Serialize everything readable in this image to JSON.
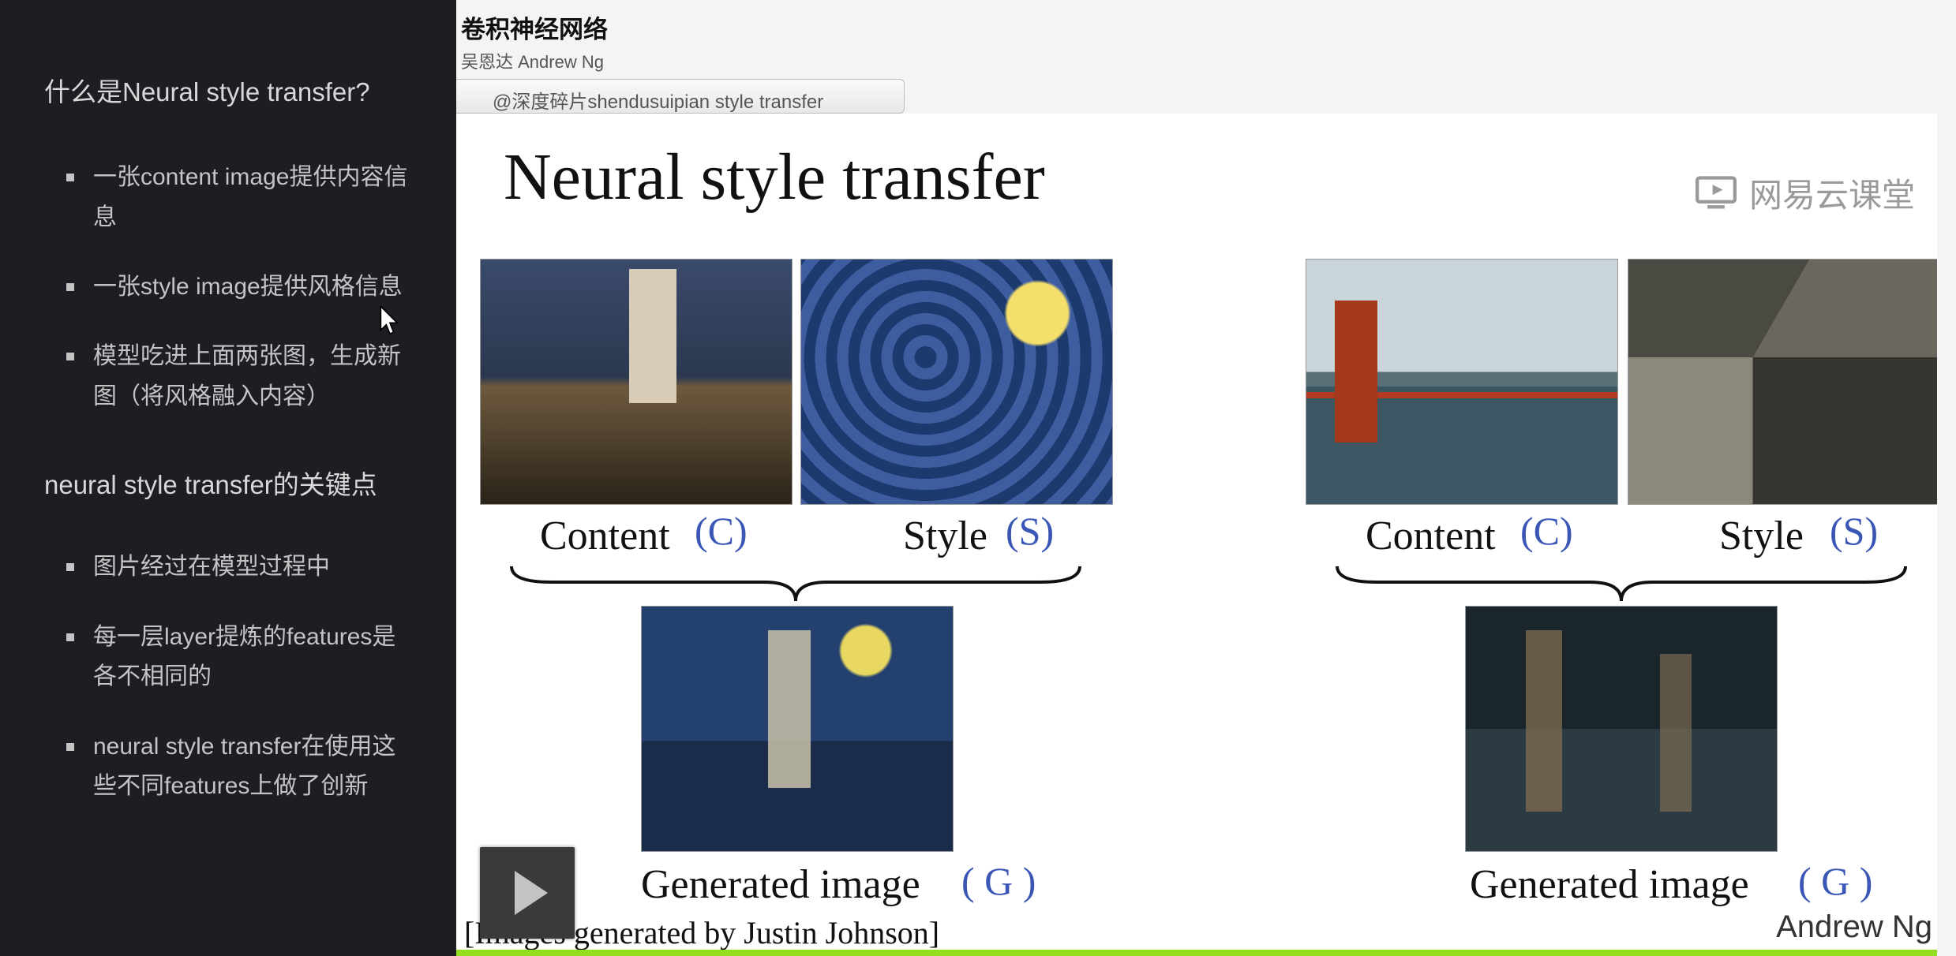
{
  "sidebar": {
    "heading1": "什么是Neural style transfer?",
    "list1": [
      "一张content image提供内容信息",
      "一张style image提供风格信息",
      "模型吃进上面两张图，生成新图（将风格融入内容）"
    ],
    "heading2": "neural style transfer的关键点",
    "list2": [
      "图片经过在模型过程中",
      "每一层layer提炼的features是各不相同的",
      "neural style transfer在使用这些不同features上做了创新"
    ]
  },
  "header": {
    "course_title": "卷积神经网络",
    "course_author": "吴恩达 Andrew Ng"
  },
  "watermark_tab": "@深度碎片shendusuipian style transfer",
  "slide": {
    "title": "Neural style transfer",
    "provider": "网易云课堂",
    "provider_icon": "monitor-play-icon",
    "left": {
      "content_label": "Content",
      "content_hand": "(C)",
      "style_label": "Style",
      "style_hand": "(S)",
      "generated_label": "Generated image",
      "generated_hand": "( G )"
    },
    "right": {
      "content_label": "Content",
      "content_hand": "(C)",
      "style_label": "Style",
      "style_hand": "(S)",
      "generated_label": "Generated image",
      "generated_hand": "( G )"
    },
    "images": {
      "c1": "hoover-tower-photo",
      "s1": "starry-night-painting",
      "g1": "tower-starry-night-generated",
      "c2": "golden-gate-bridge-photo",
      "s2": "cubist-painting",
      "g2": "bridge-cubist-generated"
    },
    "credit": "[Images generated by Justin Johnson]",
    "author": "Andrew Ng"
  },
  "player": {
    "play_icon": "play-icon"
  }
}
